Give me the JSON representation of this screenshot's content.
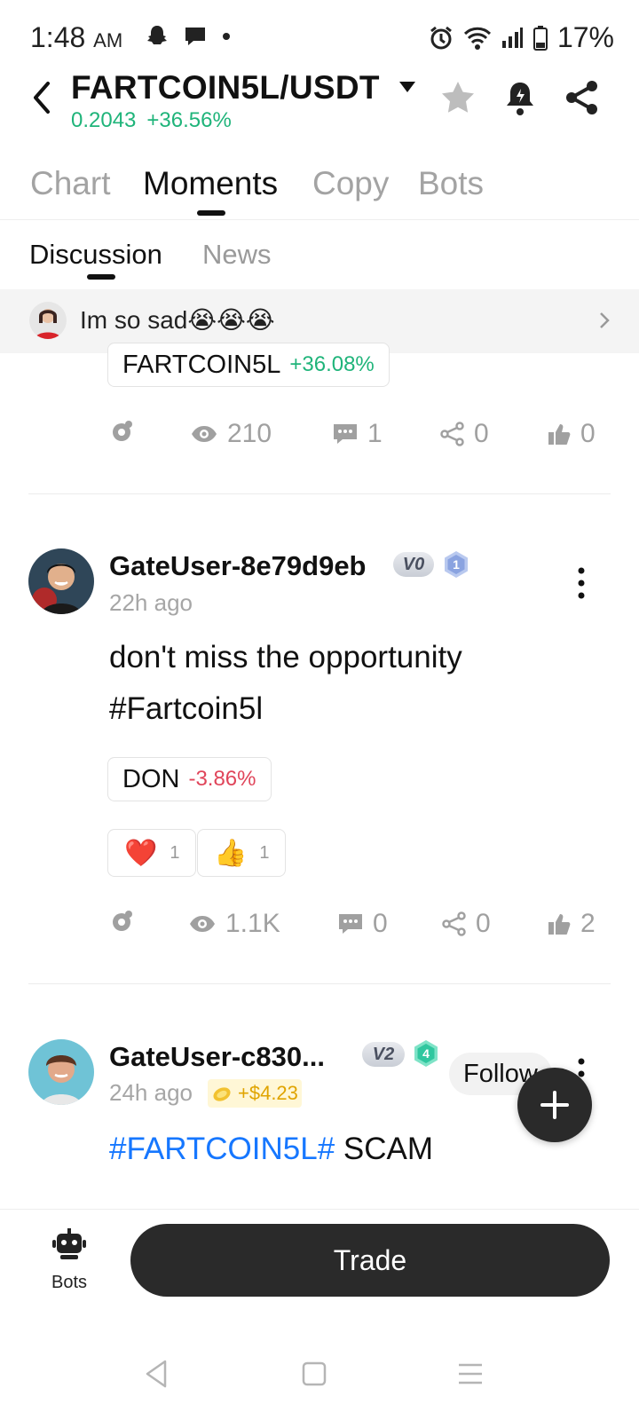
{
  "status_bar": {
    "time": "1:48",
    "ampm": "AM",
    "battery": "17%",
    "icons": [
      "snapchat-icon",
      "chat-bubble-icon",
      "dot-icon",
      "alarm-icon",
      "wifi-icon",
      "signal-icon",
      "battery-icon"
    ]
  },
  "header": {
    "pair": "FARTCOIN5L/USDT",
    "price": "0.2043",
    "change": "+36.56%",
    "icons": [
      "back-icon",
      "caret-down-icon",
      "star-icon",
      "alert-bell-icon",
      "share-icon"
    ]
  },
  "main_tabs": [
    {
      "label": "Chart",
      "active": false
    },
    {
      "label": "Moments",
      "active": true
    },
    {
      "label": "Copy",
      "active": false
    },
    {
      "label": "Bots",
      "active": false
    }
  ],
  "sub_tabs": [
    {
      "label": "Discussion",
      "active": true
    },
    {
      "label": "News",
      "active": false
    }
  ],
  "banner": {
    "text": "Im so sad😭😭😭"
  },
  "post_partial": {
    "token": {
      "symbol": "FARTCOIN5L",
      "change": "+36.08%"
    },
    "stats": {
      "views": "210",
      "comments": "1",
      "shares": "0",
      "likes": "0"
    }
  },
  "posts": [
    {
      "username": "GateUser-8e79d9eb",
      "vip": "V0",
      "level": "1",
      "time": "22h ago",
      "text_line1": "don't miss the opportunity",
      "text_line2": "#Fartcoin5l",
      "token": {
        "symbol": "DON",
        "change": "-3.86%"
      },
      "reactions": [
        {
          "emoji": "❤️",
          "count": "1"
        },
        {
          "emoji": "👍",
          "count": "1"
        }
      ],
      "stats": {
        "views": "1.1K",
        "comments": "0",
        "shares": "0",
        "likes": "2"
      }
    },
    {
      "username": "GateUser-c830...",
      "vip": "V2",
      "level": "4",
      "time": "24h ago",
      "pnl": "+$4.23",
      "follow_label": "Follow",
      "hashtag": "#FARTCOIN5L#",
      "text": "SCAM"
    }
  ],
  "bottom_bar": {
    "bots_label": "Bots",
    "trade_label": "Trade"
  },
  "colors": {
    "positive": "#1fb47a",
    "negative": "#e0455a",
    "link": "#1677ff",
    "dark_button": "#2a2a2a"
  }
}
